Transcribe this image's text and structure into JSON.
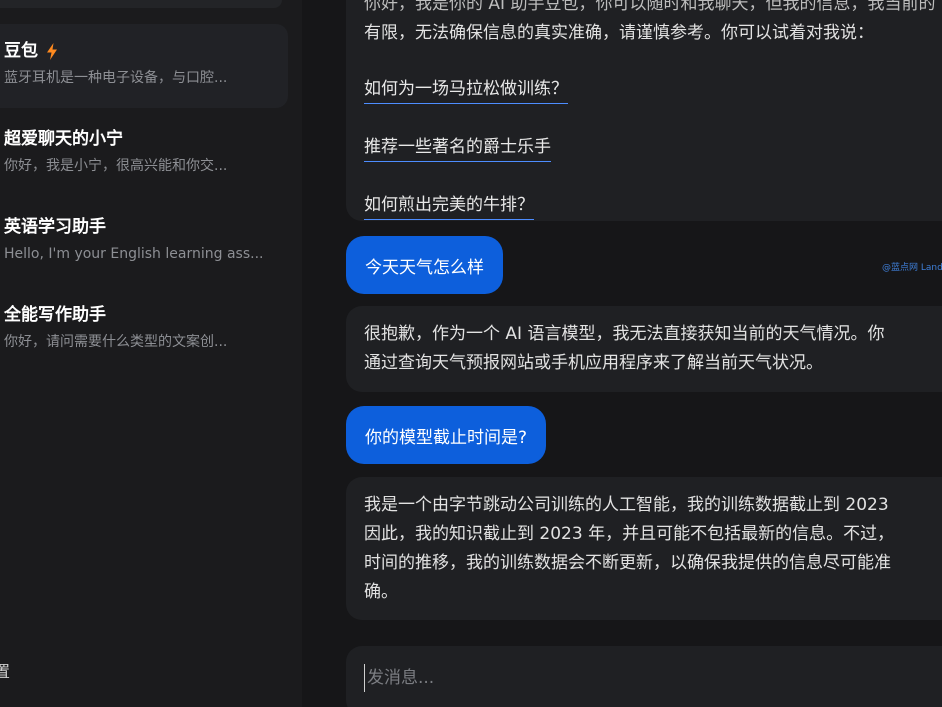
{
  "sidebar": {
    "conversations": [
      {
        "title": "豆包",
        "preview": "蓝牙耳机是一种电子设备，与口腔...",
        "active": true,
        "badge_icon": "lightning-bolt-icon"
      },
      {
        "title": "超爱聊天的小宁",
        "preview": "你好，我是小宁，很高兴能和你交...",
        "active": false
      },
      {
        "title": "英语学习助手",
        "preview": "Hello, I'm your English learning ass...",
        "active": false
      },
      {
        "title": "全能写作助手",
        "preview": "你好，请问需要什么类型的文案创...",
        "active": false
      }
    ],
    "bottom_glyph": "置"
  },
  "chat": {
    "intro_partial_line": "有限，无法确保信息的真实准确，请谨慎参考。你可以试着对我说：",
    "intro_top_fragment": "你好，我是你的 AI 助手豆包，你可以随时和我聊天，但我的信息，我当前的",
    "suggestions": [
      "如何为一场马拉松做训练？",
      "推荐一些著名的爵士乐手",
      "如何煎出完美的牛排？"
    ],
    "messages": [
      {
        "role": "user",
        "text": "今天天气怎么样"
      },
      {
        "role": "bot",
        "lines": [
          "很抱歉，作为一个 AI 语言模型，我无法直接获知当前的天气情况。你",
          "通过查询天气预报网站或手机应用程序来了解当前天气状况。"
        ]
      },
      {
        "role": "user",
        "text": "你的模型截止时间是?"
      },
      {
        "role": "bot",
        "lines": [
          "我是一个由字节跳动公司训练的人工智能，我的训练数据截止到 2023",
          "因此，我的知识截止到 2023 年，并且可能不包括最新的信息。不过，",
          "时间的推移，我的训练数据会不断更新，以确保我提供的信息尽可能准",
          "确。"
        ]
      }
    ],
    "watermark": "@蓝点网 Landian.News"
  },
  "composer": {
    "placeholder": "发消息..."
  },
  "colors": {
    "accent_blue": "#0d5fdc",
    "bolt_orange": "#ff8a1f",
    "bubble_dark": "#1f2023",
    "link_underline": "#4d8dff"
  }
}
